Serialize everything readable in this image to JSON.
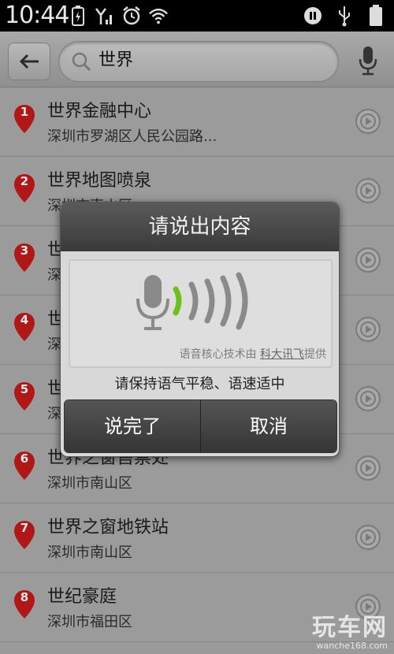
{
  "status_bar": {
    "time": "10:44",
    "icons": [
      "battery-icon",
      "signal-icon",
      "alarm-icon",
      "wifi-icon",
      "voicemail-icon",
      "usb-icon",
      "battery-full-icon"
    ]
  },
  "search": {
    "query": "世界"
  },
  "results": [
    {
      "num": "1",
      "title": "世界金融中心",
      "address": "深圳市罗湖区人民公园路..."
    },
    {
      "num": "2",
      "title": "世界地图喷泉",
      "address": "深圳市南山区"
    },
    {
      "num": "3",
      "title": "世",
      "address": "深"
    },
    {
      "num": "4",
      "title": "世",
      "address": "深"
    },
    {
      "num": "5",
      "title": "世",
      "address": "深"
    },
    {
      "num": "6",
      "title": "世界之窗售票处",
      "address": "深圳市南山区"
    },
    {
      "num": "7",
      "title": "世界之窗地铁站",
      "address": "深圳市南山区"
    },
    {
      "num": "8",
      "title": "世纪豪庭",
      "address": "深圳市福田区"
    }
  ],
  "dialog": {
    "title": "请说出内容",
    "credit_prefix": "语音核心技术由",
    "credit_brand": "科大讯飞",
    "credit_suffix": "提供",
    "hint": "请保持语气平稳、语速适中",
    "done_label": "说完了",
    "cancel_label": "取消"
  },
  "watermark": {
    "main": "玩车网",
    "url": "wanche168.com"
  },
  "colors": {
    "pin_red": "#b01818",
    "voice_green": "#6cc21a",
    "voice_gray": "#8a8a8a"
  }
}
